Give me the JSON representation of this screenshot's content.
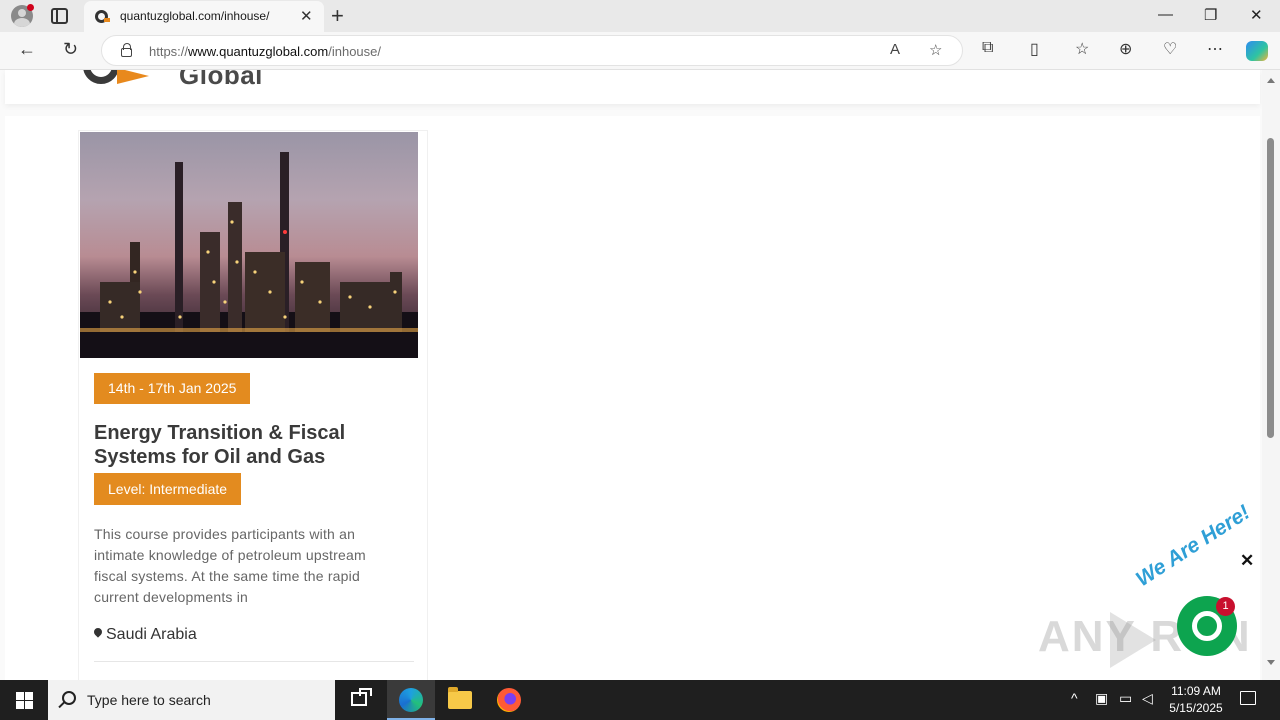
{
  "browser": {
    "tab_title": "quantuzglobal.com/inhouse/",
    "url_prefix": "https://",
    "url_domain": "www.quantuzglobal.com",
    "url_path": "/inhouse/",
    "new_tab_glyph": "+",
    "close_tab_glyph": "✕",
    "minimize_glyph": "—",
    "restore_glyph": "❐",
    "close_window_glyph": "✕"
  },
  "site": {
    "logo_text": "Global"
  },
  "course": {
    "date": "14th - 17th Jan 2025",
    "title": "Energy Transition & Fiscal Systems for Oil and Gas",
    "level": "Level: Intermediate",
    "description": "This course provides participants with an intimate knowledge of petroleum upstream fiscal systems. At the same time the rapid current developments in",
    "location": "Saudi Arabia"
  },
  "chat": {
    "tagline": "We Are Here!",
    "count": "1",
    "close_glyph": "✕"
  },
  "watermark": {
    "text": "ANY RUN"
  },
  "taskbar": {
    "search_placeholder": "Type here to search",
    "time": "11:09 AM",
    "date": "5/15/2025"
  },
  "colors": {
    "accent": "#e38b1f",
    "chat_green": "#0da44f",
    "tagline_blue": "#2f9fd6"
  }
}
